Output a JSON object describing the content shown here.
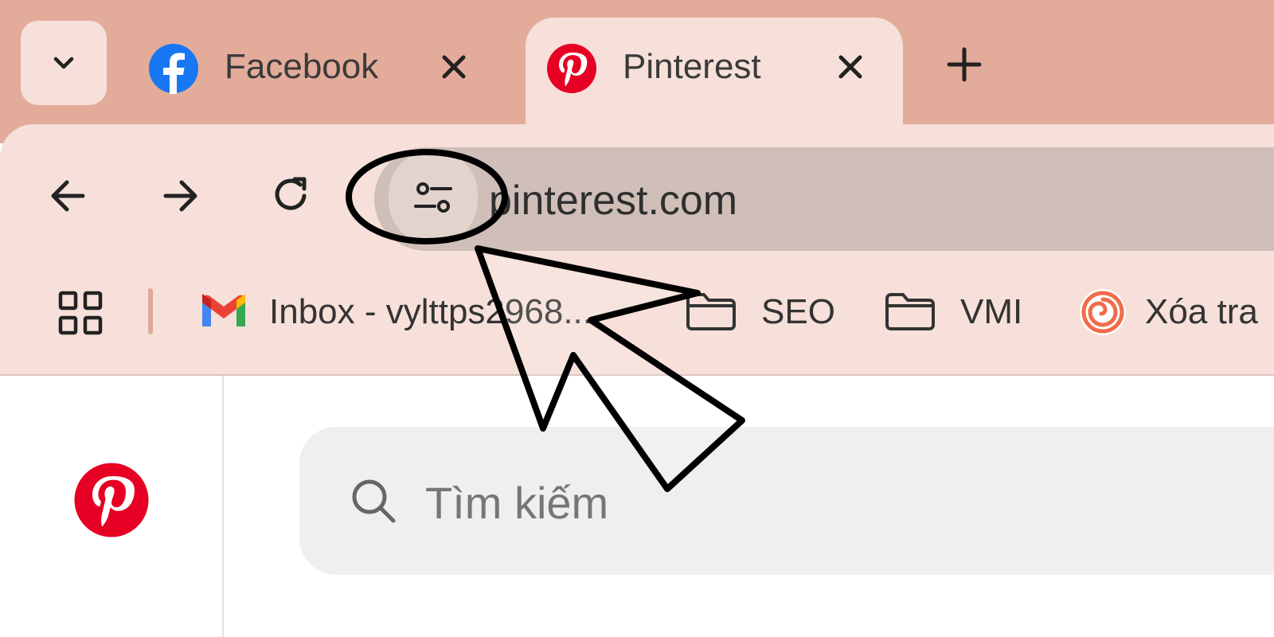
{
  "browser": {
    "tabs": [
      {
        "title": "Facebook",
        "favicon": "facebook-icon",
        "active": false
      },
      {
        "title": "Pinterest",
        "favicon": "pinterest-icon",
        "active": true
      }
    ],
    "address": {
      "url": "pinterest.com"
    },
    "bookmarks": [
      {
        "label": "Inbox - vylttps2968...",
        "icon": "gmail-icon"
      },
      {
        "label": "SEO",
        "icon": "folder-icon"
      },
      {
        "label": "VMI",
        "icon": "folder-icon"
      },
      {
        "label": "Xóa tra",
        "icon": "swirl-icon"
      }
    ]
  },
  "page": {
    "search_placeholder": "Tìm kiếm"
  },
  "colors": {
    "tabstrip": "#e3ab9a",
    "toolbar": "#f6e0d9",
    "omnibox": "#cfbfb8",
    "pinterest_red": "#e60023",
    "facebook_blue": "#1877f2"
  }
}
